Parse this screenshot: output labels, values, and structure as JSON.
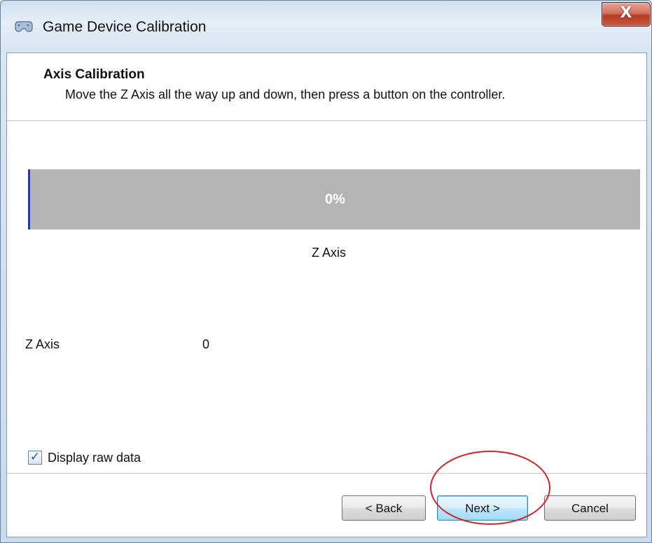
{
  "window": {
    "title": "Game Device Calibration",
    "close_glyph": "X",
    "icon": "game-controller-icon"
  },
  "header": {
    "title": "Axis Calibration",
    "description": "Move the Z Axis all the way up and down, then press a button on the controller."
  },
  "progress": {
    "percent_label": "0%",
    "value": 0,
    "caption": "Z Axis",
    "fill_color": "#2a3a9a",
    "track_color": "#b4b4b4"
  },
  "raw": {
    "label": "Z Axis",
    "value": "0"
  },
  "options": {
    "display_raw_label": "Display raw data",
    "display_raw_checked": true,
    "check_glyph": "✓"
  },
  "buttons": {
    "back": "< Back",
    "next": "Next >",
    "cancel": "Cancel"
  },
  "annotation": {
    "color": "#d0232a",
    "target": "next-button"
  }
}
